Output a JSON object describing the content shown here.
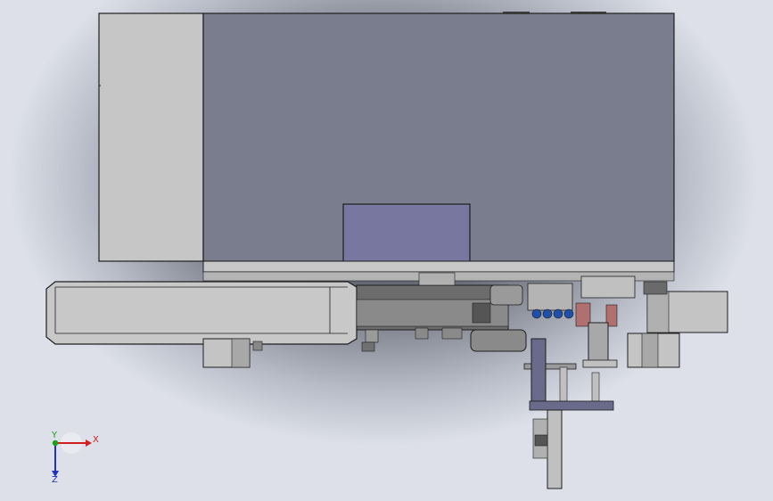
{
  "viewport": {
    "background_center": "#3c3f48",
    "background_edge": "#dde0e8"
  },
  "model": {
    "colors": {
      "housing_side": "#c6c6c6",
      "housing_front": "#7a7d8e",
      "access_panel": "#7777a0",
      "rail": "#c8c8c8",
      "dark_part": "#5a5a5a",
      "cylinder_blue": "#1f4fa8",
      "cylinder_red": "#b07070",
      "outline": "#1e1e1e"
    }
  },
  "triad": {
    "x_label": "X",
    "y_label": "Y",
    "z_label": "Z",
    "x_color": "#d22020",
    "y_color": "#1aa01a",
    "z_color": "#2030c0"
  }
}
